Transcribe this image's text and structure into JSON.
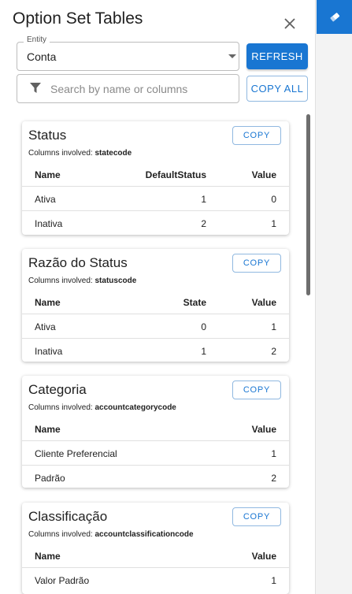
{
  "header": {
    "title": "Option Set Tables"
  },
  "entity": {
    "label": "Entity",
    "value": "Conta"
  },
  "search": {
    "placeholder": "Search by name or columns"
  },
  "buttons": {
    "refresh": "REFRESH",
    "copy_all": "COPY ALL"
  },
  "colors": {
    "accent": "#1976d2"
  },
  "cards": [
    {
      "title": "Status",
      "columns_prefix": "Columns involved:",
      "columns": "statecode",
      "copy": "COPY",
      "headers": [
        "Name",
        "DefaultStatus",
        "Value"
      ],
      "rows": [
        [
          "Ativa",
          "1",
          "0"
        ],
        [
          "Inativa",
          "2",
          "1"
        ]
      ]
    },
    {
      "title": "Razão do Status",
      "columns_prefix": "Columns involved:",
      "columns": "statuscode",
      "copy": "COPY",
      "headers": [
        "Name",
        "State",
        "Value"
      ],
      "rows": [
        [
          "Ativa",
          "0",
          "1"
        ],
        [
          "Inativa",
          "1",
          "2"
        ]
      ]
    },
    {
      "title": "Categoria",
      "columns_prefix": "Columns involved:",
      "columns": "accountcategorycode",
      "copy": "COPY",
      "headers": [
        "Name",
        "Value"
      ],
      "rows": [
        [
          "Cliente Preferencial",
          "1"
        ],
        [
          "Padrão",
          "2"
        ]
      ]
    },
    {
      "title": "Classificação",
      "columns_prefix": "Columns involved:",
      "columns": "accountclassificationcode",
      "copy": "COPY",
      "headers": [
        "Name",
        "Value"
      ],
      "rows": [
        [
          "Valor Padrão",
          "1"
        ]
      ]
    }
  ]
}
